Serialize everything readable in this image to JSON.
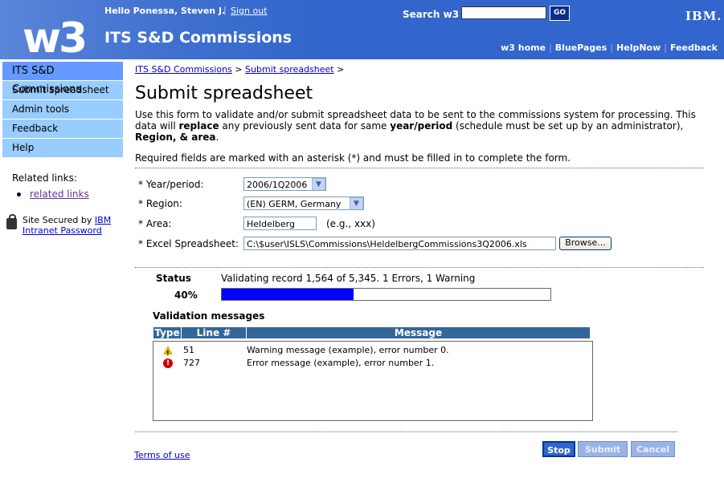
{
  "masthead": {
    "greeting": "Hello Ponessa, Steven J.",
    "separator": "|",
    "sign_out": "Sign out",
    "logo": "w3",
    "site_title": "ITS S&D Commissions",
    "search_label": "Search w3",
    "search_value": "",
    "go_label": "GO",
    "ibm_logo": "IBM.",
    "links": [
      "w3 home",
      "BluePages",
      "HelpNow",
      "Feedback"
    ]
  },
  "sidebar": {
    "items": [
      {
        "label": "ITS S&D Commissions",
        "active": true
      },
      {
        "label": "Submit spreadsheet",
        "active": false
      },
      {
        "label": "Admin tools",
        "active": false
      },
      {
        "label": "Feedback",
        "active": false
      },
      {
        "label": "Help",
        "active": false
      }
    ],
    "related_title": "Related links:",
    "related_link": "related links",
    "secured_text": "Site Secured by",
    "secured_link_1": "IBM",
    "secured_link_2": "Intranet Password"
  },
  "breadcrumb": {
    "items": [
      "ITS S&D Commissions",
      "Submit spreadsheet"
    ],
    "separator": ">"
  },
  "page_title": "Submit spreadsheet",
  "intro": {
    "part1": "Use this form to validate and/or submit spreadsheet data to be sent to the commissions system for processing. This data will ",
    "b1": "replace",
    "part2": " any previously sent data for same ",
    "b2": "year/period",
    "part3": " (schedule must be set up by an administrator), ",
    "b3": "Region, & area",
    "part4": "."
  },
  "required_note": "Required fields are marked with an asterisk (*) and must be filled in to complete the form.",
  "form": {
    "year_label": "* Year/period:",
    "year_value": "2006/1Q2006",
    "region_label": "* Region:",
    "region_value": "(EN) GERM, Germany",
    "area_label": "* Area:",
    "area_value": "Heldelberg",
    "area_hint": "(e.g., xxx)",
    "excel_label": "* Excel Spreadsheet:",
    "excel_value": "C:\\$user\\ISLS\\Commissions\\HeldelbergCommissions3Q2006.xls",
    "browse_label": "Browse..."
  },
  "status": {
    "label": "Status",
    "text": "Validating record 1,564 of 5,345. 1 Errors, 1 Warning",
    "percent_label": "40%",
    "progress": 0.4
  },
  "validation": {
    "title": "Validation messages",
    "columns": [
      "Type",
      "Line #",
      "Message"
    ],
    "rows": [
      {
        "type": "warning",
        "line": "51",
        "message": "Warning message (example), error number 0."
      },
      {
        "type": "error",
        "line": "727",
        "message": "Error message (example), error number 1."
      }
    ]
  },
  "footer": {
    "terms": "Terms of use",
    "stop": "Stop",
    "submit": "Submit",
    "cancel": "Cancel"
  },
  "colors": {
    "masthead": "#3366CC",
    "nav": "#99CCFF",
    "nav_active": "#6699FF",
    "progress": "#0000FF",
    "table_header": "#336699"
  }
}
